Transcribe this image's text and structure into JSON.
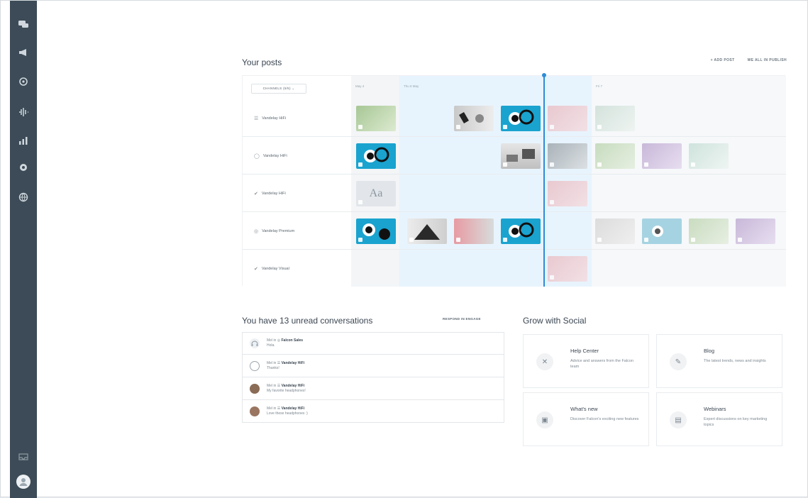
{
  "colors": {
    "sidebar": "#3c4b57",
    "accent": "#2d8cd6",
    "past_bg": "#f3f5f7",
    "current_bg": "#e8f4fd",
    "future_bg": "#f6f8fa"
  },
  "sidebar": {
    "items": [
      {
        "icon": "chat-icon"
      },
      {
        "icon": "megaphone-icon"
      },
      {
        "icon": "compass-icon"
      },
      {
        "icon": "audio-wave-icon"
      },
      {
        "icon": "analytics-icon"
      },
      {
        "icon": "settings-icon"
      },
      {
        "icon": "globe-icon"
      }
    ],
    "bottom": [
      {
        "icon": "inbox-icon"
      },
      {
        "icon": "user-avatar-icon"
      }
    ]
  },
  "posts": {
    "title": "Your posts",
    "add_post": "+ ADD POST",
    "view_all": "WE ALL IN PUBLISH",
    "channels_button": "CHANNELS (5/5) ⌄",
    "columns": [
      "May 4",
      "Thu 6 May",
      "Fri 7"
    ],
    "rows": [
      {
        "label": "Vandelay HiFi",
        "glyph": "☰"
      },
      {
        "label": "Vandelay HiFi",
        "glyph": "◯"
      },
      {
        "label": "Vandelay HiFi",
        "glyph": "✔"
      },
      {
        "label": "Vandelay Premium",
        "glyph": "◎"
      },
      {
        "label": "Vandelay Visual",
        "glyph": "✔"
      }
    ]
  },
  "conversations": {
    "title": "You have 13 unread conversations",
    "respond_button": "RESPOND IN ENGAGE",
    "items": [
      {
        "from": "Mel in ◎",
        "channel": "Falcon Sales",
        "message": "Hola."
      },
      {
        "from": "Mel in ☰",
        "channel": "Vandelay HiFi",
        "message": "Thanks!"
      },
      {
        "from": "Mel in ☰",
        "channel": "Vandelay HiFi",
        "message": "My favorite headphones!"
      },
      {
        "from": "Mel in ☰",
        "channel": "Vandelay HiFi",
        "message": "Love these headphones :)"
      }
    ]
  },
  "grow": {
    "title": "Grow with Social",
    "cards": [
      {
        "title": "Help Center",
        "desc": "Advice and answers from the Falcon team",
        "icon": "tools-icon"
      },
      {
        "title": "Blog",
        "desc": "The latest trends, news and insights",
        "icon": "pen-icon"
      },
      {
        "title": "What's new",
        "desc": "Discover Falcon's exciting new features",
        "icon": "gift-icon"
      },
      {
        "title": "Webinars",
        "desc": "Expert discussions on key marketing topics",
        "icon": "video-icon"
      }
    ]
  }
}
